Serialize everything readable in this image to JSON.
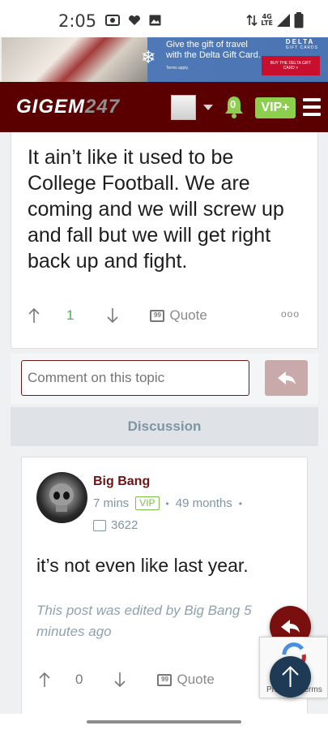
{
  "status_bar": {
    "time": "2:05",
    "network": "4G LTE"
  },
  "ad": {
    "headline_line1": "Give the gift of travel",
    "headline_line2": "with the Delta Gift Card.",
    "fine_print": "Terms apply.",
    "brand": "DELTA",
    "brand_sub": "GIFT CARDS",
    "cta": "BUY THE DELTA GIFT CARD >"
  },
  "navbar": {
    "logo_main": "GIGEM",
    "logo_suffix": "247",
    "notification_count": "0",
    "vip_label": "VIP+"
  },
  "post1": {
    "body": "It ain’t like it used to be College Football. We are coming and we will screw up and fall but we will get right back up and fight.",
    "upvotes": "1",
    "quote_label": "Quote",
    "more_label": "ooo"
  },
  "comment": {
    "placeholder": "Comment on this topic"
  },
  "discussion": {
    "label": "Discussion"
  },
  "post2": {
    "username": "Big Bang",
    "time": "7 mins",
    "badge": "VIP",
    "membership": "49 months",
    "post_count": "3622",
    "body": "it’s not even like last year.",
    "edited_note": "This post was edited by Big Bang 5 minutes ago",
    "upvotes": "0",
    "quote_label": "Quote"
  },
  "recaptcha": {
    "text": "Privacy - Terms"
  },
  "colors": {
    "brand_maroon": "#5a0000",
    "vip_green": "#8ccf4d",
    "link_gray": "#7f95a5"
  }
}
